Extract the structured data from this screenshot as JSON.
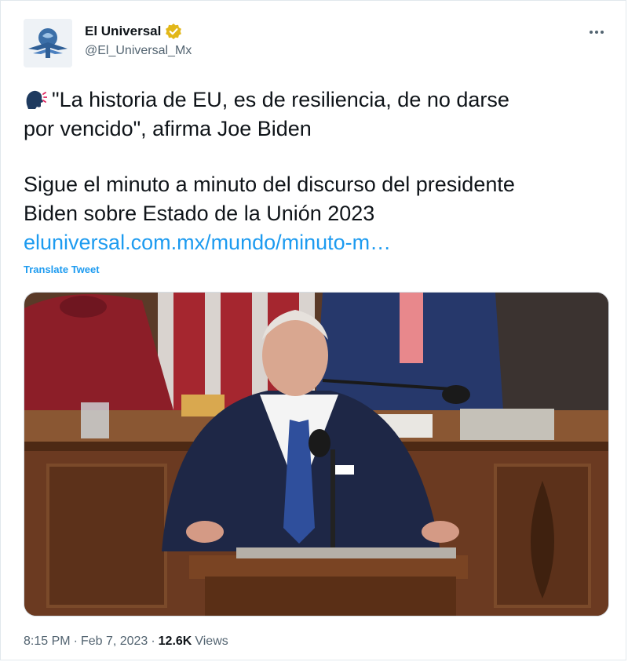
{
  "author": {
    "display_name": "El Universal",
    "handle": "@El_Universal_Mx",
    "verified_color": "#e2b719"
  },
  "tweet": {
    "emoji_icon": "speaking-head-icon",
    "line1": "\"La historia de EU, es de resiliencia, de no darse",
    "line2": "por vencido\", afirma Joe Biden",
    "line3": "Sigue el minuto a minuto del discurso del presidente",
    "line4": "Biden sobre Estado de la Unión 2023",
    "link_text": "eluniversal.com.mx/mundo/minuto-m…",
    "translate_label": "Translate Tweet"
  },
  "meta": {
    "time": "8:15 PM",
    "separator1": "·",
    "date": "Feb 7, 2023",
    "separator2": "·",
    "views_count": "12.6K",
    "views_label": "Views"
  },
  "colors": {
    "link": "#1d9bf0",
    "text": "#0f1419",
    "secondary": "#536471"
  }
}
